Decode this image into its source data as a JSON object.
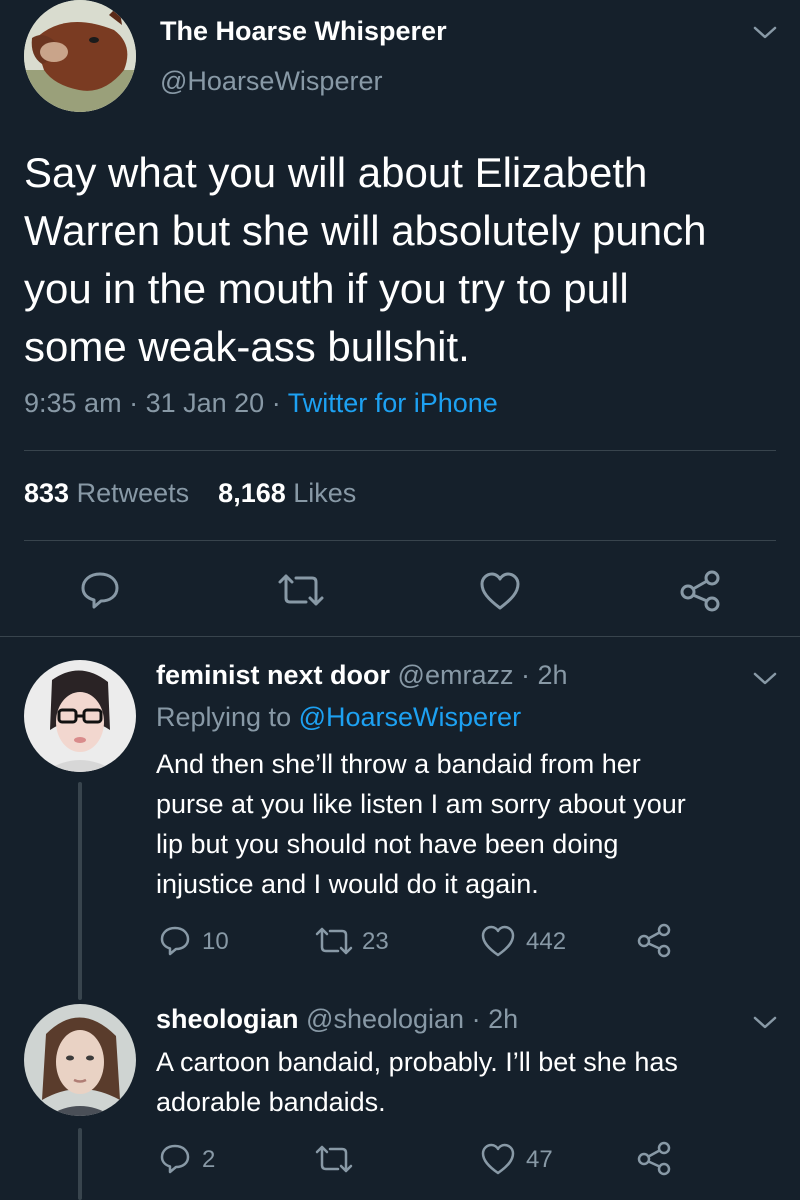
{
  "main_tweet": {
    "display_name": "The Hoarse Whisperer",
    "handle": "@HoarseWisperer",
    "text_lines": [
      "Say what you will about Elizabeth",
      "Warren but she will absolutely punch",
      "you in the mouth if you try to pull",
      "some weak-ass bullshit."
    ],
    "time": "9:35 am",
    "date": "31 Jan 20",
    "separator": "·",
    "source": "Twitter for iPhone",
    "retweets_count": "833",
    "retweets_label": "Retweets",
    "likes_count": "8,168",
    "likes_label": "Likes"
  },
  "replies": [
    {
      "display_name": "feminist next door",
      "handle": "@emrazz",
      "time": "· 2h",
      "replying_prefix": "Replying to",
      "replying_to": "@HoarseWisperer",
      "text_lines": [
        "And then she’ll throw a bandaid from her",
        "purse at you like listen I am sorry about your",
        "lip but you should not have been doing",
        "injustice and I would do it again."
      ],
      "reply_count": "10",
      "retweet_count": "23",
      "like_count": "442"
    },
    {
      "display_name": "sheologian",
      "handle": "@sheologian",
      "time": "· 2h",
      "text_lines": [
        "A cartoon bandaid, probably. I’ll bet she has",
        "adorable bandaids."
      ],
      "reply_count": "2",
      "retweet_count": "",
      "like_count": "47"
    }
  ],
  "colors": {
    "background": "#15202b",
    "muted": "#8899a6",
    "link": "#1da1f2",
    "divider": "#38444d"
  },
  "icons": [
    "chevron-down-icon",
    "reply-icon",
    "retweet-icon",
    "like-icon",
    "share-icon"
  ]
}
